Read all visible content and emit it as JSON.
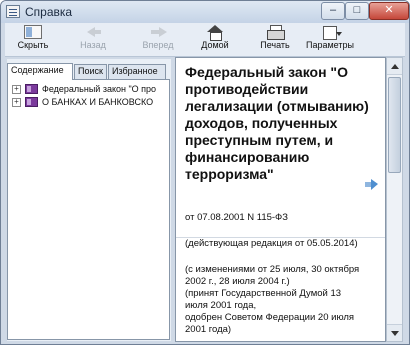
{
  "window": {
    "title": "Справка"
  },
  "title_buttons": {
    "minimize": "–",
    "maximize": "□",
    "close": "✕"
  },
  "toolbar": {
    "hide": "Скрыть",
    "back": "Назад",
    "forward": "Вперед",
    "home": "Домой",
    "print": "Печать",
    "options": "Параметры"
  },
  "icons": {
    "hide": "hide-pane-icon",
    "back": "back-arrow-icon",
    "forward": "forward-arrow-icon",
    "home": "home-icon",
    "print": "printer-icon",
    "options": "options-icon",
    "book": "book-icon",
    "next": "next-topic-icon"
  },
  "tabs": {
    "contents": "Содержание",
    "search": "Поиск",
    "favorites": "Избранное"
  },
  "tree": {
    "items": [
      {
        "expander": "+",
        "label": "Федеральный закон \"О про"
      },
      {
        "expander": "+",
        "label": "О БАНКАХ И БАНКОВСКО"
      }
    ]
  },
  "document": {
    "title": "Федеральный закон \"О противодействии легализации (отмыванию) доходов, полученных преступным путем, и финансированию терроризма\"",
    "meta": {
      "date": "от 07.08.2001 N 115-ФЗ",
      "edition": "(действующая редакция от 05.05.2014)",
      "changes_1": "(с изменениями от 25 июля, 30 октября",
      "changes_2": "2002 г., 28 июля 2004 г.)",
      "adopted_1": "(принят Государственной Думой 13",
      "adopted_2": "июля 2001 года,",
      "approved_1": "одобрен Советом Федерации 20 июля",
      "approved_2": "2001 года)"
    }
  },
  "colors": {
    "window_frame": "#cfd9e6",
    "close_button": "#c5473a",
    "book_icon": "#7b3a9c",
    "next_arrow": "#4f8fd0"
  }
}
